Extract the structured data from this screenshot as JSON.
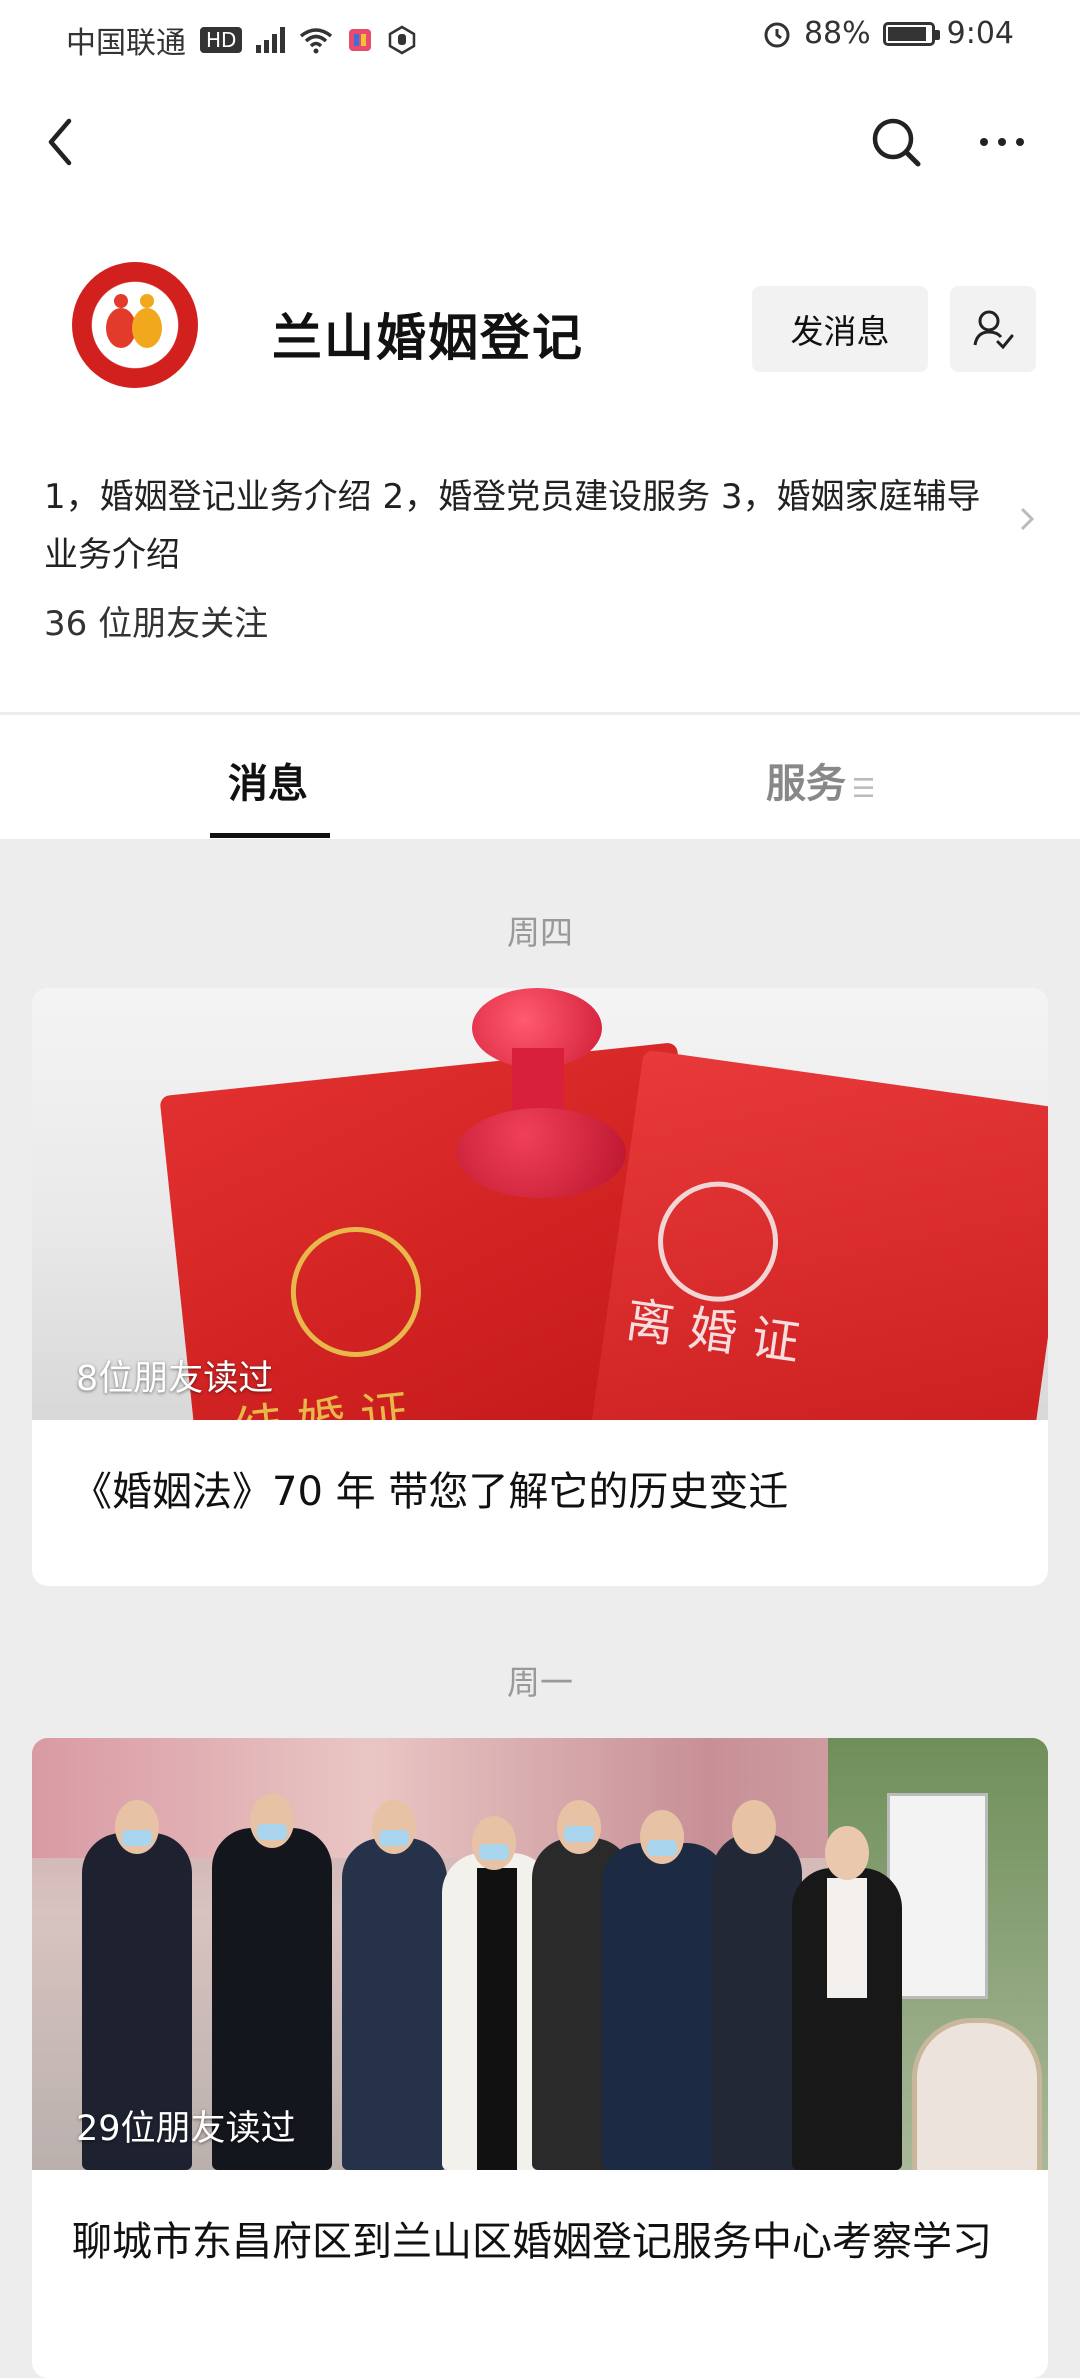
{
  "status_bar": {
    "carrier": "中国联通",
    "hd": "HD",
    "battery": "88%",
    "battery_level": 0.88,
    "time": "9:04"
  },
  "nav": {
    "back_icon": "chevron-left-icon",
    "search_icon": "search-icon",
    "more_icon": "more-dots-icon"
  },
  "profile": {
    "name": "兰山婚姻登记",
    "send_message": "发消息",
    "user_icon": "user-check-icon",
    "description": "1，婚姻登记业务介绍 2，婚登党员建设服务 3，婚姻家庭辅导业务介绍",
    "followers": "36 位朋友关注"
  },
  "tabs": [
    {
      "label": "消息",
      "active": true
    },
    {
      "label": "服务",
      "active": false
    }
  ],
  "feed": [
    {
      "day": "周四",
      "read_count": "8位朋友读过",
      "title": "《婚姻法》70 年 带您了解它的历史变迁",
      "image_text": [
        "结 婚 证",
        "离 婚 证"
      ]
    },
    {
      "day": "周一",
      "read_count": "29位朋友读过",
      "title": "聊城市东昌府区到兰山区婚姻登记服务中心考察学习"
    }
  ]
}
